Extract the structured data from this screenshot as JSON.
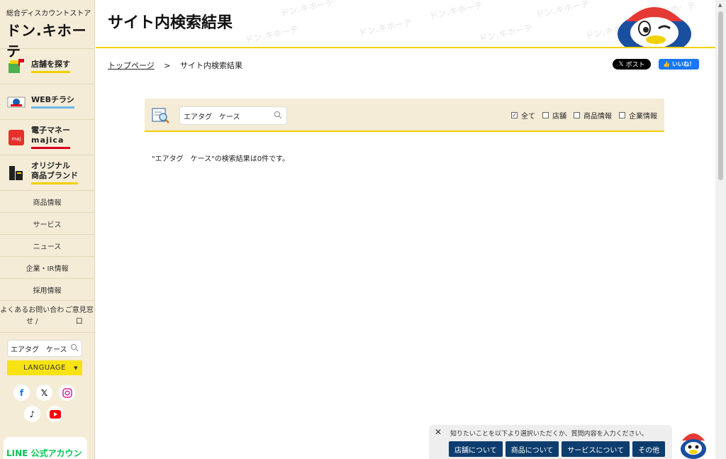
{
  "colors": {
    "brand_yellow": "#f2d100",
    "sidebar_bg": "#f5ecd7",
    "chat_button": "#0d3d6e",
    "facebook": "#1877f2"
  },
  "sidebar": {
    "logo_sub": "総合ディスカウントストア",
    "logo_main": "ドン.キホーテ",
    "big_items": [
      {
        "label": "店舗を探す",
        "icon": "store-icon"
      },
      {
        "label": "WEBチラシ",
        "icon": "flyer-icon"
      },
      {
        "label_line1": "電子マネー",
        "label_line2": "majica",
        "icon": "majica-card-icon"
      },
      {
        "label_line1": "オリジナル",
        "label_line2": "商品ブランド",
        "icon": "brand-icon"
      }
    ],
    "small_items": [
      "商品情報",
      "サービス",
      "ニュース",
      "企業・IR情報",
      "採用情報"
    ],
    "contact_line1": "よくあるお問い合わせ /",
    "contact_line2": "ご意見窓口",
    "search_value": "エアタグ　ケース",
    "language_label": "LANGUAGE",
    "line_label": "LINE 公式アカウント"
  },
  "header": {
    "title": "サイト内検索結果",
    "watermark": "ドン.キホーテ"
  },
  "breadcrumb": {
    "home": "トップページ",
    "separator": ">",
    "current": "サイト内検索結果"
  },
  "share": {
    "x_label": "ポスト",
    "fb_label": "いいね！"
  },
  "search": {
    "query": "エアタグ　ケース",
    "filters": [
      {
        "label": "全て",
        "checked": true
      },
      {
        "label": "店舗",
        "checked": false
      },
      {
        "label": "商品情報",
        "checked": false
      },
      {
        "label": "企業情報",
        "checked": false
      }
    ],
    "result_text": "\"エアタグ　ケース\"の検索結果は0件です。"
  },
  "chat": {
    "message": "知りたいことを以下より選択いただくか、質問内容を入力ください。",
    "options": [
      "店舗について",
      "商品について",
      "サービスについて",
      "その他"
    ]
  }
}
